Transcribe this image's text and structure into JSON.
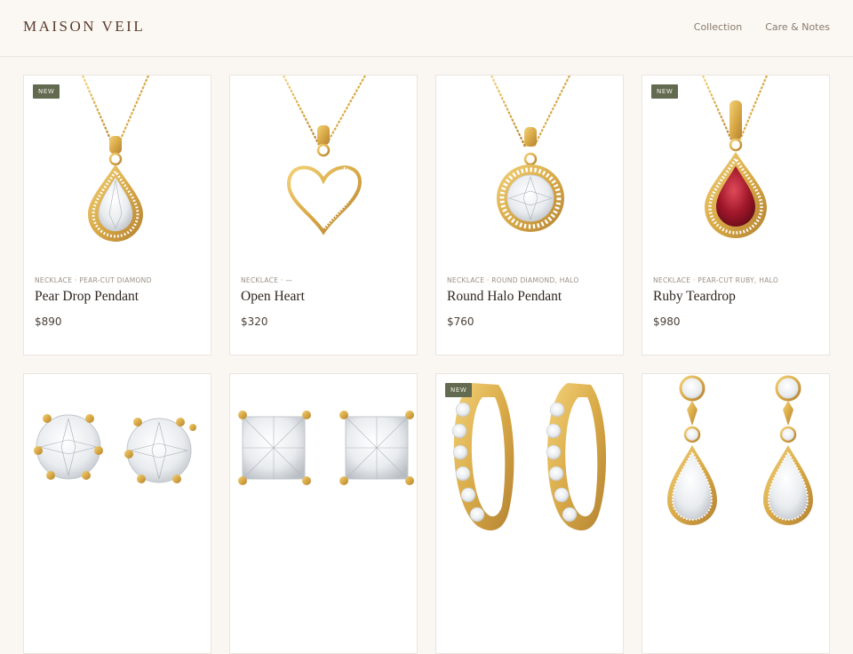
{
  "brand": {
    "name": "MAISON VEIL"
  },
  "nav": {
    "items": [
      "Collection",
      "Care & Notes"
    ]
  },
  "colors": {
    "badge": "#626b50",
    "gold": "#d9aa47",
    "ruby": "#a0172a",
    "background": "#faf6f2"
  },
  "products": [
    {
      "badge": "NEW",
      "meta": "NECKLACE · PEAR-CUT DIAMOND",
      "title": "Pear Drop Pendant",
      "price": "$890",
      "image": "pear-diamond-pendant"
    },
    {
      "badge": "",
      "meta": "NECKLACE · —",
      "title": "Open Heart",
      "price": "$320",
      "image": "open-heart-pendant"
    },
    {
      "badge": "",
      "meta": "NECKLACE · ROUND DIAMOND, HALO",
      "title": "Round Halo Pendant",
      "price": "$760",
      "image": "round-halo-pendant"
    },
    {
      "badge": "NEW",
      "meta": "NECKLACE · PEAR-CUT RUBY, HALO",
      "title": "Ruby Teardrop",
      "price": "$980",
      "image": "ruby-teardrop-pendant"
    },
    {
      "badge": "",
      "meta": "",
      "title": "",
      "price": "",
      "image": "round-stud-earrings"
    },
    {
      "badge": "",
      "meta": "",
      "title": "",
      "price": "",
      "image": "princess-stud-earrings"
    },
    {
      "badge": "NEW",
      "meta": "",
      "title": "",
      "price": "",
      "image": "pave-hoop-earrings"
    },
    {
      "badge": "",
      "meta": "",
      "title": "",
      "price": "",
      "image": "pear-drop-earrings"
    }
  ]
}
